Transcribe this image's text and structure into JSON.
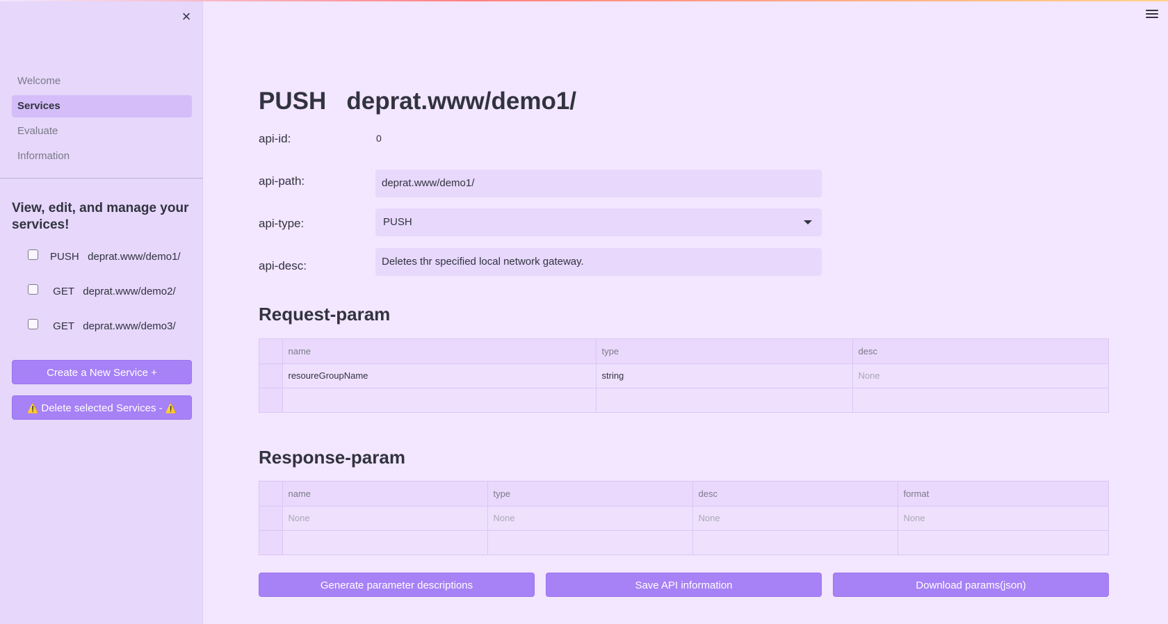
{
  "sidebar": {
    "nav": [
      {
        "label": "Welcome"
      },
      {
        "label": "Services"
      },
      {
        "label": "Evaluate"
      },
      {
        "label": "Information"
      }
    ],
    "heading": "View, edit, and manage your services!",
    "services": [
      {
        "label": "PUSH   deprat.www/demo1/",
        "checked": false
      },
      {
        "label": " GET   deprat.www/demo2/",
        "checked": false
      },
      {
        "label": " GET   deprat.www/demo3/",
        "checked": false
      }
    ],
    "create_button": "Create a New Service +",
    "delete_button": "Delete selected Services -",
    "warn_glyph": "⚠️"
  },
  "main": {
    "title": "PUSH   deprat.www/demo1/",
    "fields": {
      "api_id_label": "api-id:",
      "api_id_value": "0",
      "api_path_label": "api-path:",
      "api_path_value": "deprat.www/demo1/",
      "api_type_label": "api-type:",
      "api_type_value": "PUSH",
      "api_desc_label": "api-desc:",
      "api_desc_value": "Deletes thr specified local network gateway."
    },
    "request": {
      "title": "Request-param",
      "columns": [
        "name",
        "type",
        "desc"
      ],
      "rows": [
        [
          "resoureGroupName",
          "string",
          "None"
        ]
      ]
    },
    "response": {
      "title": "Response-param",
      "columns": [
        "name",
        "type",
        "desc",
        "format"
      ],
      "rows": [
        [
          "None",
          "None",
          "None",
          "None"
        ]
      ]
    },
    "buttons": {
      "generate": "Generate parameter descriptions",
      "save": "Save API information",
      "download": "Download params(json)"
    }
  },
  "colors": {
    "accent": "#a781f6",
    "background": "#f3e6ff",
    "sidebar": "#e6d7fb"
  }
}
